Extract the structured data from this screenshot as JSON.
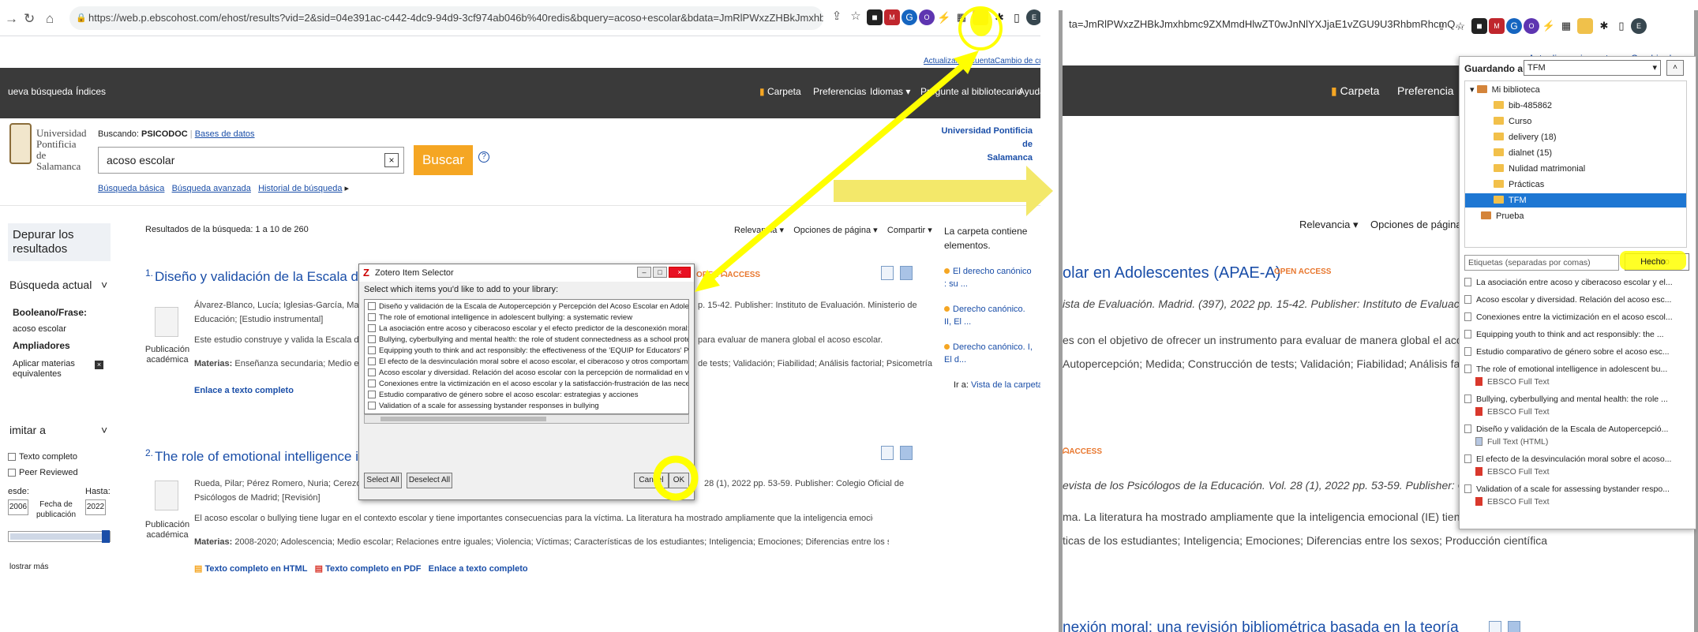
{
  "colors": {
    "accent_yellow": "#ffff00",
    "ebsco_orange": "#f5a623",
    "nav_dark": "#3a3a3a",
    "link_blue": "#1a4ea8"
  },
  "left": {
    "browser": {
      "url": "https://web.p.ebscohost.com/ehost/results?vid=2&sid=04e391ac-c442-4dc9-94d9-3cf974ab046b%40redis&bquery=acoso+escolar&bdata=JmRlPWxzZHBkJmxhbmc9ZXMmdHlwZT0wJnNlYXJjaE1vZGU9U3RhbmRhcmQ%3d",
      "url_display": "https://web.p.ebscohost.com/ehost/results?vid=2&sid=04e391ac-c442-4dc9-94d9-3cf974ab046b%40redis&bquery=acoso+escolar&bdata=JmRlPWxzZHBkJmxhbmc9ZXMmdHlwZT0wJnNlYXJjaE1vZGU9U3RhbmRhcmQ..."
    },
    "top_links": {
      "account": "Actualizar mi cuenta",
      "change": "Cambio de cuenta"
    },
    "nav": {
      "new_search": "ueva búsqueda",
      "indexes": "Índices",
      "folder": "Carpeta",
      "prefs": "Preferencias",
      "languages": "Idiomas",
      "ask": "Pregunte al bibliotecario",
      "help": "Ayuda"
    },
    "logo": {
      "line1": "Universidad",
      "line2": "Pontificia",
      "line3": "de Salamanca"
    },
    "search": {
      "searching_label": "Buscando:",
      "db": "PSICODOC",
      "db_link": "Bases de datos",
      "query": "acoso escolar",
      "button": "Buscar",
      "basic": "Búsqueda básica",
      "advanced": "Búsqueda avanzada",
      "history": "Historial de búsqueda"
    },
    "institution": {
      "line1": "Universidad Pontificia de",
      "line2": "Salamanca"
    },
    "sidebar": {
      "refine": "Depurar los resultados",
      "current": "Búsqueda actual",
      "boolean": "Booleano/Frase:",
      "boolean_value": "acoso escolar",
      "expanders": "Ampliadores",
      "apply": "Aplicar materias equivalentes",
      "limit": "imitar a",
      "full_text": "Texto completo",
      "peer": "Peer Reviewed",
      "from": "esde:",
      "to": "Hasta:",
      "from_year": "2006",
      "to_year": "2022",
      "pub_date": "Fecha de publicación",
      "show_more": "lostrar más"
    },
    "results": {
      "summary": "Resultados de la búsqueda: 1 a 10 de 260",
      "relevance": "Relevancia",
      "page_options": "Opciones de página",
      "share": "Compartir",
      "pub_type": "Publicación académica",
      "items": [
        {
          "num": "1.",
          "title": "Diseño y validación de la Escala de Autopercepción y Percepción del Acoso Escolar en Adolescentes (APAE-A)",
          "authors": "Álvarez-Blanco, Lucía; Iglesias-García, María-Teresa;",
          "meta_tail": "p. 15-42. Publisher: Instituto de Evaluación. Ministerio de",
          "meta2": "Educación; [Estudio instrumental]",
          "abstract": "Este estudio construye y valida la Escala de Auto",
          "abstract_tail": "para evaluar de manera global el acoso escolar.",
          "subjects_label": "Materias:",
          "subjects": "Enseñanza secundaria; Medio escolar;",
          "subjects_tail": "de tests; Validación; Fiabilidad; Análisis factorial; Psicometría",
          "link1": "Enlace a texto completo"
        },
        {
          "num": "2.",
          "title": "The role of emotional intelligence in adolescent bullying: a systematic review",
          "authors": "Rueda, Pilar; Pérez Romero, Nuria; Cerezo, M. Victoria;",
          "meta_tail": "28 (1), 2022 pp. 53-59. Publisher: Colegio Oficial de",
          "meta2": "Psicólogos de Madrid; [Revisión]",
          "abstract": "El acoso escolar o bullying tiene lugar en el contexto escolar y tiene importantes consecuencias para la víctima. La literatura ha mostrado ampliamente que la inteligencia emocional (IE) tiene un...",
          "subjects_label": "Materias:",
          "subjects": "2008-2020; Adolescencia; Medio escolar; Relaciones entre iguales; Violencia; Víctimas; Características de los estudiantes; Inteligencia; Emociones; Diferencias entre los sexos; Producción científica",
          "link_html": "Texto completo en HTML",
          "link_pdf": "Texto completo en PDF",
          "link1": "Enlace a texto completo"
        }
      ]
    },
    "carpeta": {
      "header": "La carpeta contiene elementos.",
      "items": [
        "El derecho canónico : su ...",
        "Derecho canónico. II, El ...",
        "Derecho canónico. I, El d..."
      ],
      "goto": "Ir a:",
      "goto_link": "Vista de la carpeta"
    },
    "zotero_dialog": {
      "title": "Zotero Item Selector",
      "prompt": "Select which items you'd like to add to your library:",
      "items": [
        "Diseño y validación de la Escala de Autopercepción y Percepción del Acoso Escolar en Adolescentes (APAE-A)",
        "The role of emotional intelligence in adolescent bullying: a systematic review",
        "La asociación entre acoso y ciberacoso escolar y el efecto predictor de la desconexión moral: una revisión bibliométrica",
        "Bullying, cyberbullying and mental health: the role of student connectedness as a school protective factor",
        "Equipping youth to think and act responsibly: the effectiveness of the 'EQUIP for Educators' Program on",
        "El efecto de la desvinculación moral sobre el acoso escolar, el ciberacoso y otros comportamientos disruptivos",
        "Acoso escolar y diversidad. Relación del acoso escolar con la percepción de normalidad en víctimas y agresores",
        "Conexiones entre la victimización en el acoso escolar y la satisfacción-frustración de las necesidades psicológicas",
        "Estudio comparativo de género sobre el acoso escolar: estrategias y acciones",
        "Validation of a scale for assessing bystander responses in bullying"
      ],
      "select_all": "Select All",
      "deselect_all": "Deselect All",
      "cancel": "Cancel",
      "ok": "OK"
    }
  },
  "right": {
    "url_fragment": "ta=JmRlPWxzZHBkJmxhbmc9ZXMmdHlwZT0wJnNlYXJjaE1vZGU9U3RhbmRhcmQ...",
    "top_links": {
      "account": "Actualizar mi cuenta",
      "change": "Cambio de cuen"
    },
    "nav": {
      "folder": "Carpeta",
      "prefs": "Preferencia"
    },
    "relevance": "Relevancia",
    "page_options": "Opciones de página",
    "title_tail": "olar en Adolescentes (APAE-A)",
    "oa": "OPEN ACCESS",
    "meta1": "ista de Evaluación. Madrid. (397), 2022 pp. 15-42. Publisher: Instituto de Evaluación. Minis",
    "abstract1": "es con el objetivo de ofrecer un instrumento para evaluar de manera global el acoso esco",
    "subjects1": "Autopercepción; Medida; Construcción de tests; Validación; Fiabilidad; Análisis factorial; P",
    "oa2": "ACCESS",
    "meta2": "evista de los Psicólogos de la Educación. Vol. 28 (1), 2022 pp. 53-59. Publisher: Colegio O",
    "abstract2": "ma. La literatura ha mostrado ampliamente que la inteligencia emocional (IE) tiene un...",
    "subjects2": "ticas de los estudiantes; Inteligencia; Emociones; Diferencias entre los sexos; Producción científica",
    "bottom_title": "nexión moral: una revisión bibliométrica basada en la teoría",
    "zotero_panel": {
      "saving_to": "Guardando a",
      "collection": "TFM",
      "tree": [
        "Mi biblioteca",
        "bib-485862",
        "Curso",
        "delivery (18)",
        "dialnet (15)",
        "Nulidad matrimonial",
        "Prácticas",
        "TFM",
        "Prueba"
      ],
      "tags_placeholder": "Etiquetas (separadas por comas)",
      "done": "Hecho",
      "items": [
        {
          "title": "La asociación entre acoso y ciberacoso escolar y el...",
          "sub": ""
        },
        {
          "title": "Acoso escolar y diversidad. Relación del acoso esc...",
          "sub": ""
        },
        {
          "title": "Conexiones entre la victimización en el acoso escol...",
          "sub": ""
        },
        {
          "title": "Equipping youth to think and act responsibly: the ...",
          "sub": ""
        },
        {
          "title": "Estudio comparativo de género sobre el acoso esc...",
          "sub": ""
        },
        {
          "title": "The role of emotional intelligence in adolescent bu...",
          "sub": "EBSCO Full Text"
        },
        {
          "title": "Bullying, cyberbullying and mental health: the role ...",
          "sub": "EBSCO Full Text"
        },
        {
          "title": "Diseño y validación de la Escala de Autopercepció...",
          "sub": "Full Text (HTML)"
        },
        {
          "title": "El efecto de la desvinculación moral sobre el acoso...",
          "sub": "EBSCO Full Text"
        },
        {
          "title": "Validation of a scale for assessing bystander respo...",
          "sub": "EBSCO Full Text"
        }
      ]
    }
  }
}
